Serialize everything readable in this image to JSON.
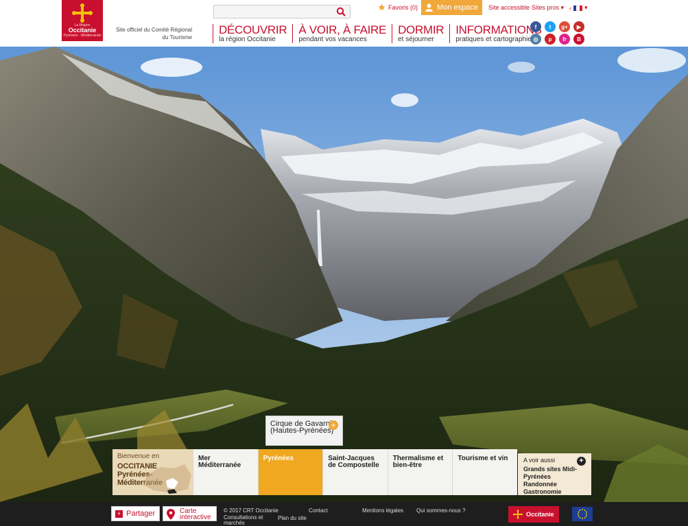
{
  "logo": {
    "small_top": "La Région",
    "name": "Occitanie",
    "small_bottom": "Pyrénées · Méditerranée"
  },
  "official_text": "Site officiel du Comité Régional du Tourisme",
  "search": {
    "placeholder": ""
  },
  "favorites": {
    "label": "Favoris (0)"
  },
  "my_space": {
    "label": "Mon espace"
  },
  "accessible": {
    "label": "Site accessible"
  },
  "pros": {
    "label": "Sites pros"
  },
  "language": {
    "current": "FR",
    "colors": [
      "#1f3f9e",
      "#ffffff",
      "#d61f26"
    ]
  },
  "nav": [
    {
      "title": "DÉCOUVRIR",
      "subtitle": "la région Occitanie"
    },
    {
      "title": "À VOIR, À FAIRE",
      "subtitle": "pendant vos vacances"
    },
    {
      "title": "DORMIR",
      "subtitle": "et séjourner"
    },
    {
      "title": "INFORMATIONS",
      "subtitle": "pratiques et cartographie"
    }
  ],
  "social": [
    {
      "icon": "facebook-icon",
      "glyph": "f",
      "color": "#3b5998"
    },
    {
      "icon": "twitter-icon",
      "glyph": "t",
      "color": "#1da1f2"
    },
    {
      "icon": "google-plus-icon",
      "glyph": "g+",
      "color": "#dd4b39"
    },
    {
      "icon": "youtube-icon",
      "glyph": "▶",
      "color": "#c4302b"
    },
    {
      "icon": "instagram-icon",
      "glyph": "◎",
      "color": "#517fa4"
    },
    {
      "icon": "pinterest-icon",
      "glyph": "p",
      "color": "#cb2027"
    },
    {
      "icon": "flickr-icon",
      "glyph": "fr",
      "color": "#e0238a"
    },
    {
      "icon": "blog-icon",
      "glyph": "B",
      "color": "#c8102e"
    }
  ],
  "hero": {
    "callout": "Cirque de Gavarnie (Hautes-Pyrénées)",
    "welcome": {
      "line1": "Bienvenue en",
      "line2": "OCCITANIE",
      "line3": "Pyrénées-Méditerranée"
    },
    "destinations": [
      {
        "label": "Mer Méditerranée",
        "active": false
      },
      {
        "label": "Pyrénées",
        "active": true
      },
      {
        "label": "Saint-Jacques de Compostelle",
        "active": false
      },
      {
        "label": "Thermalisme et bien-être",
        "active": false
      },
      {
        "label": "Tourisme et vin",
        "active": false
      }
    ],
    "see_also": {
      "title": "A voir aussi",
      "items": [
        "Grands sites Midi-Pyrénées",
        "Randonnée",
        "Gastronomie"
      ]
    }
  },
  "footer": {
    "share": "Partager",
    "map": "Carte interactive",
    "copyright": "© 2017 CRT Occitanie",
    "consultations": "Consultations et marchés",
    "sitemap": "Plan du site",
    "contact": "Contact",
    "legal": "Mentions légales",
    "who": "Qui sommes-nous ?",
    "logo_name": "Occitanie"
  }
}
